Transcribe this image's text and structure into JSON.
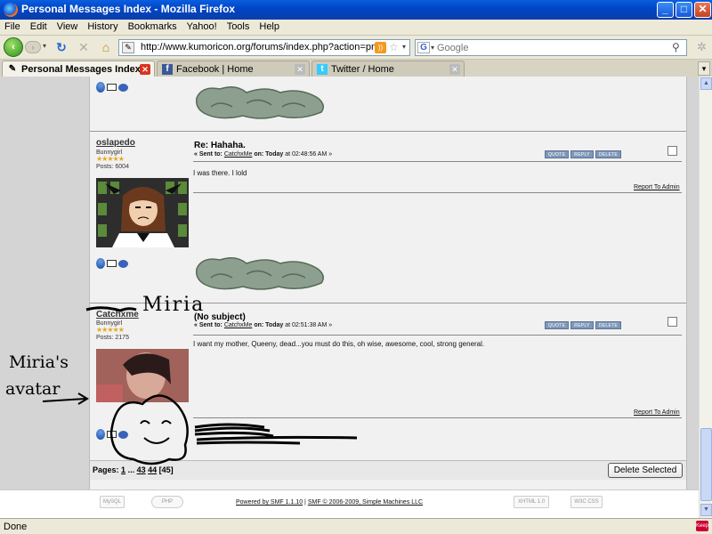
{
  "window": {
    "title": "Personal Messages Index - Mozilla Firefox"
  },
  "menu": [
    "File",
    "Edit",
    "View",
    "History",
    "Bookmarks",
    "Yahoo!",
    "Tools",
    "Help"
  ],
  "nav": {
    "url": "http://www.kumoricon.org/forums/index.php?action=pm;f=",
    "search_placeholder": "Google"
  },
  "tabs": [
    {
      "label": "Personal Messages Index",
      "active": true
    },
    {
      "label": "Facebook | Home",
      "active": false
    },
    {
      "label": "Twitter / Home",
      "active": false
    }
  ],
  "messages": [
    {
      "username": "oslapedo",
      "rank": "Bunnygirl",
      "stars": "★★★★★",
      "posts": "Posts: 6004",
      "subject": "Re: Hahaha.",
      "sent_prefix": "« Sent to:",
      "recipient": "CatchxMe",
      "on_label": "on:",
      "date_bold": "Today",
      "time": "at 02:48:56 AM »",
      "body": "I was there. I lold",
      "buttons": [
        "QUOTE",
        "REPLY",
        "DELETE"
      ],
      "report": "Report To Admin"
    },
    {
      "username": "Catchxme",
      "rank": "Bunnygirl",
      "stars": "★★★★★",
      "posts": "Posts: 2175",
      "subject": "(No subject)",
      "sent_prefix": "« Sent to:",
      "recipient": "CatchxMe",
      "on_label": "on:",
      "date_bold": "Today",
      "time": "at 02:51:38 AM »",
      "body": "I want my mother, Queeny, dead...you must do this, oh wise, awesome, cool, strong general.",
      "buttons": [
        "QUOTE",
        "REPLY",
        "DELETE"
      ],
      "report": "Report To Admin"
    }
  ],
  "pagination": {
    "label": "Pages:",
    "first": "1",
    "ellipsis": "...",
    "p43": "43",
    "p44": "44",
    "current": "[45]"
  },
  "delete_selected": "Delete Selected",
  "footer": {
    "powered": "Powered by SMF 1.1.10",
    "sep": "|",
    "copyright": "SMF © 2006-2009, Simple Machines LLC"
  },
  "badges": [
    "MySQL",
    "PHP",
    "XHTML 1.0",
    "W3C CSS"
  ],
  "status": "Done",
  "annotations": {
    "name": "Miria",
    "avatar_note_1": "Miria's",
    "avatar_note_2": "avatar"
  }
}
